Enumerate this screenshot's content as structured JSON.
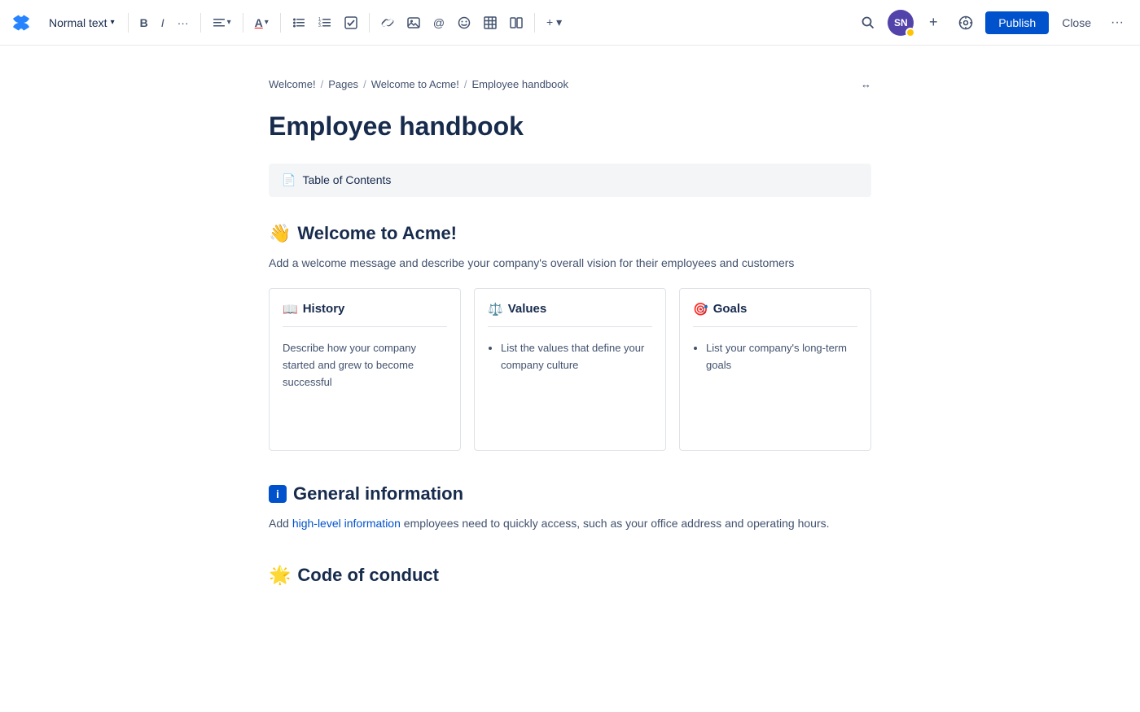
{
  "toolbar": {
    "logo_label": "Confluence logo",
    "text_style": "Normal text",
    "bold_label": "B",
    "italic_label": "I",
    "more_label": "···",
    "align_label": "≡",
    "color_label": "A",
    "bullet_label": "≡",
    "numbered_label": "≡",
    "task_label": "☑",
    "link_label": "🔗",
    "image_label": "🖼",
    "mention_label": "@",
    "emoji_label": "☺",
    "table_label": "⊞",
    "columns_label": "⊟",
    "insert_label": "+▾",
    "search_label": "🔍",
    "avatar_initials": "SN",
    "invite_label": "+",
    "space_label": "⊕",
    "publish_label": "Publish",
    "close_label": "Close",
    "more_options_label": "···"
  },
  "breadcrumb": {
    "items": [
      "Welcome!",
      "Pages",
      "Welcome to Acme!",
      "Employee handbook"
    ],
    "separators": [
      "/",
      "/",
      "/"
    ],
    "expand_label": "↔"
  },
  "page": {
    "title": "Employee handbook"
  },
  "toc": {
    "label": "Table of Contents",
    "icon": "📄"
  },
  "sections": [
    {
      "id": "welcome",
      "emoji": "👋",
      "heading": "Welcome to Acme!",
      "description": "Add a welcome message and describe your company's overall vision for their employees and customers",
      "cards": [
        {
          "emoji": "📖",
          "title": "History",
          "body_type": "text",
          "body": "Describe how your company started and grew to become successful"
        },
        {
          "emoji": "⚖️",
          "title": "Values",
          "body_type": "list",
          "items": [
            "List the values that define your company culture"
          ]
        },
        {
          "emoji": "🎯",
          "title": "Goals",
          "body_type": "list",
          "items": [
            "List your company's long-term goals"
          ]
        }
      ]
    },
    {
      "id": "general",
      "emoji": "ℹ️",
      "heading": "General information",
      "description": "Add high-level information employees need to quickly access, such as your office address and operating hours.",
      "has_link": true,
      "link_word": "high-level information",
      "cards": []
    },
    {
      "id": "conduct",
      "emoji": "🌟",
      "heading": "Code of conduct",
      "description": "",
      "cards": []
    }
  ]
}
